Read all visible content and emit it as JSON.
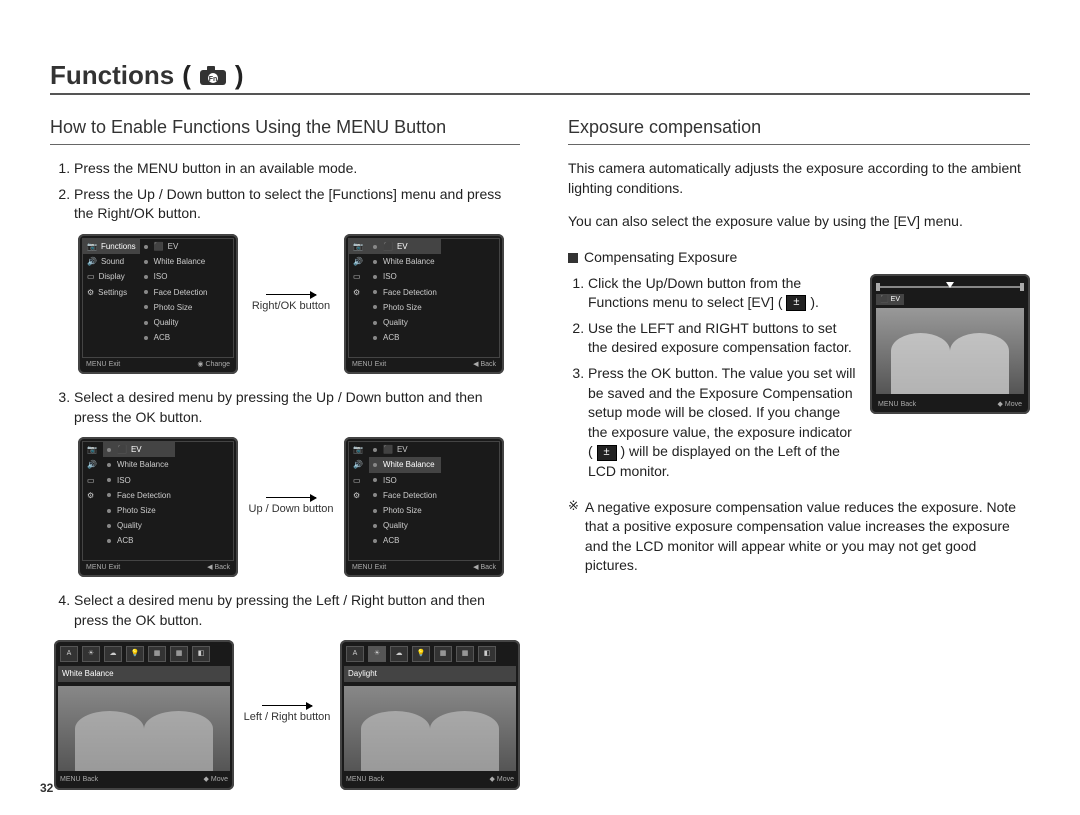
{
  "page": {
    "title": "Functions",
    "number": "32"
  },
  "left": {
    "heading": "How to Enable Functions Using the MENU Button",
    "steps": {
      "s1": "Press the MENU button in an available mode.",
      "s2": "Press the Up / Down button to select the [Functions] menu and press the Right/OK button.",
      "s3": "Select a desired menu by pressing the Up / Down button and then press the OK button.",
      "s4": "Select a desired menu by pressing the Left / Right button and then press the OK button."
    },
    "arrows": {
      "a1": "Right/OK button",
      "a2": "Up / Down button",
      "a3": "Left / Right button"
    }
  },
  "right": {
    "heading": "Exposure compensation",
    "intro1": "This camera automatically adjusts the exposure according to the ambient lighting conditions.",
    "intro2": "You can also select the exposure value by using the [EV] menu.",
    "subheading": "Compensating Exposure",
    "steps": {
      "c1a": "Click the Up/Down button from the Functions menu to select [EV] (",
      "c1b": ").",
      "c2": "Use the LEFT and RIGHT buttons to set the desired exposure compensation factor.",
      "c3a": "Press the OK button. The value you set will be saved and the Exposure Compensation setup mode will be closed. If you change the exposure value, the exposure indicator (",
      "c3b": ") will be displayed on the Left of the LCD monitor."
    },
    "note_sym": "※",
    "note": "A negative exposure compensation value reduces the exposure. Note that a positive exposure compensation value increases the exposure and the LCD monitor will appear white or you may not get good pictures."
  },
  "lcd": {
    "functions_label": "Functions",
    "side": {
      "sound": "Sound",
      "display": "Display",
      "settings": "Settings"
    },
    "menu": {
      "ev": "EV",
      "wb": "White Balance",
      "iso": "ISO",
      "face": "Face Detection",
      "size": "Photo Size",
      "quality": "Quality",
      "acb": "ACB"
    },
    "wb_daylight": "Daylight",
    "footer": {
      "exit": "Exit",
      "change": "Change",
      "back": "Back",
      "move": "Move",
      "menu": "MENU"
    },
    "ev_label": "EV"
  }
}
